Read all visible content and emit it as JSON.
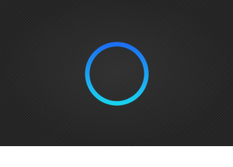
{
  "background": {
    "color": "#262626",
    "texture": "diagonal-crosshatch"
  },
  "ring": {
    "icon": "circle-ring-icon",
    "gradient_top": "#1e6ff2",
    "gradient_bottom": "#19d2f0"
  }
}
